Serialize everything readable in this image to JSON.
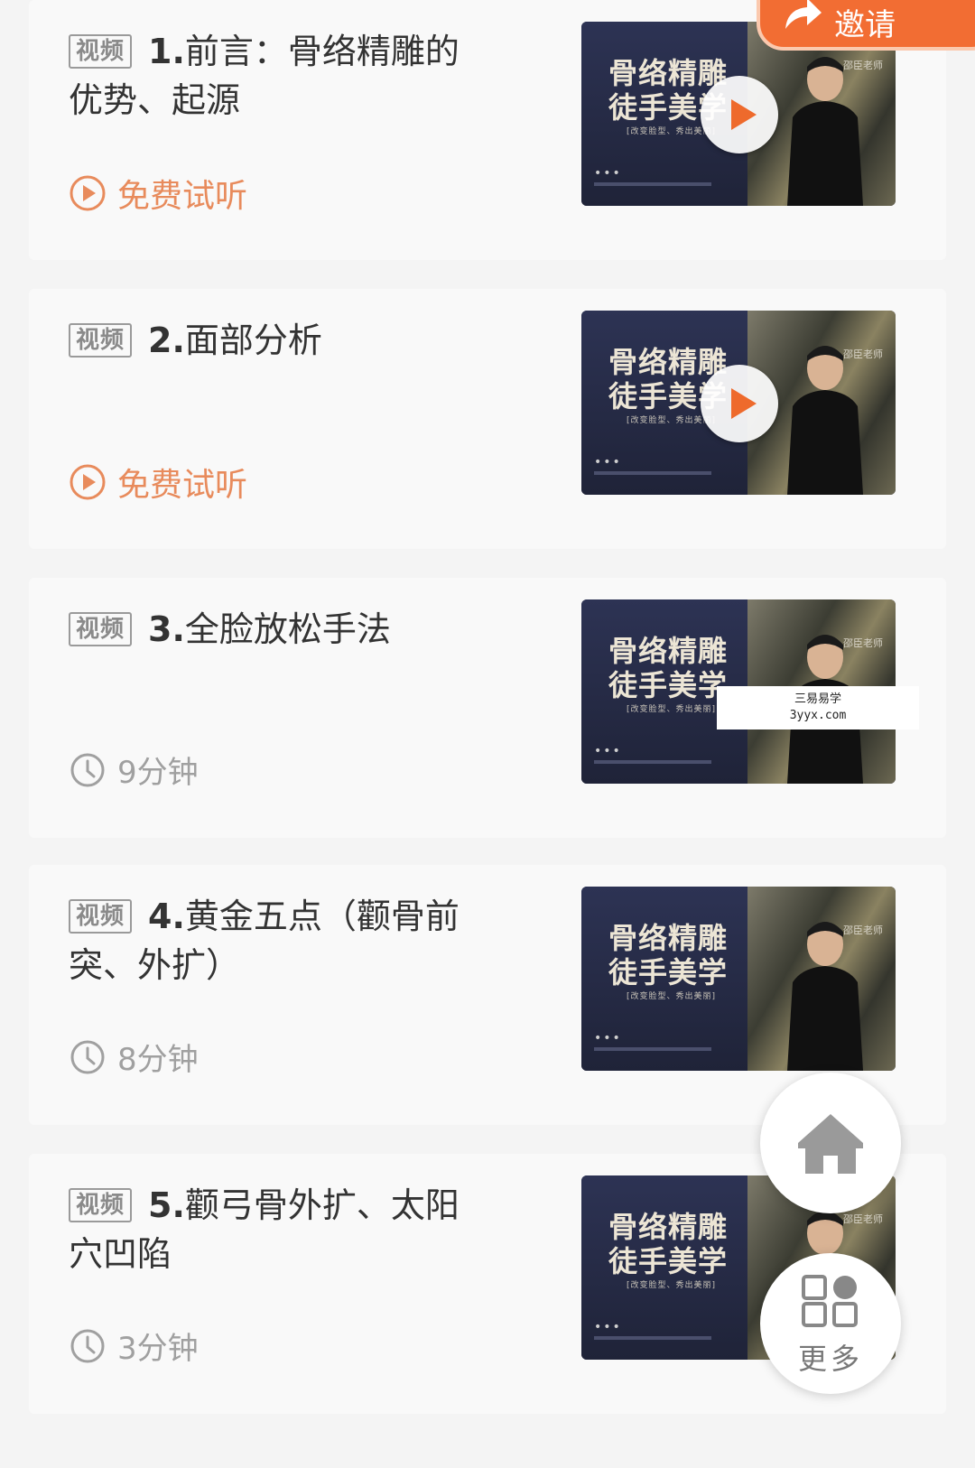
{
  "header": {
    "invite_label": "邀请"
  },
  "badge_label": "视频",
  "free_label": "免费试听",
  "thumbnail": {
    "title_line1": "骨络精雕",
    "title_line2": "徒手美学",
    "tagline": "[改变脸型、秀出美丽]",
    "teacher": "邵臣老师"
  },
  "lessons": [
    {
      "num": "1.",
      "title": "前言：骨络精雕的优势、起源",
      "status": "free",
      "has_play": true
    },
    {
      "num": "2.",
      "title": "面部分析",
      "status": "free",
      "has_play": true
    },
    {
      "num": "3.",
      "title": "全脸放松手法",
      "status": "duration",
      "duration": "9分钟",
      "has_play": false
    },
    {
      "num": "4.",
      "title": "黄金五点（颧骨前突、外扩）",
      "status": "duration",
      "duration": "8分钟",
      "has_play": false
    },
    {
      "num": "5.",
      "title": "颧弓骨外扩、太阳穴凹陷",
      "status": "duration",
      "duration": "3分钟",
      "has_play": false
    }
  ],
  "watermark": {
    "line1": "三易易学",
    "line2": "3yyx.com"
  },
  "fab": {
    "more_label": "更多"
  },
  "colors": {
    "accent": "#f26d33",
    "free_text": "#e88b5c",
    "play_triangle": "#ee6a2c"
  }
}
